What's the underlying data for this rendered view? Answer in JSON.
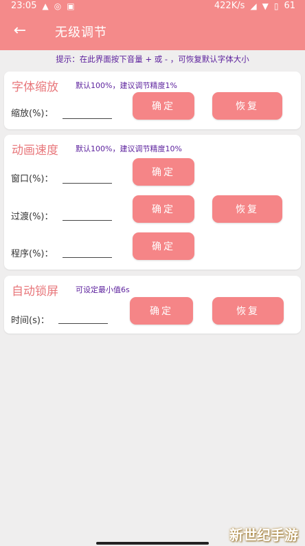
{
  "status": {
    "time": "23:05",
    "speed": "422K/s",
    "battery": "61"
  },
  "appbar": {
    "back_icon": "←",
    "title": "无级调节"
  },
  "hint": "提示：在此界面按下音量 + 或 - ，可恢复默认字体大小",
  "cards": [
    {
      "title": "字体缩放",
      "subtitle": "默认100%，建议调节精度1%",
      "rows": [
        {
          "label": "缩放(%)：",
          "value": "",
          "confirm": "确定",
          "restore": "恢复"
        }
      ]
    },
    {
      "title": "动画速度",
      "subtitle": "默认100%，建议调节精度10%",
      "rows": [
        {
          "label": "窗口(%)：",
          "value": "",
          "confirm": "确定"
        },
        {
          "label": "过渡(%)：",
          "value": "",
          "confirm": "确定",
          "restore": "恢复"
        },
        {
          "label": "程序(%)：",
          "value": "",
          "confirm": "确定"
        }
      ]
    },
    {
      "title": "自动锁屏",
      "subtitle": "可设定最小值6s",
      "rows": [
        {
          "label": "时间(s)：",
          "value": "",
          "confirm": "确定",
          "restore": "恢复"
        }
      ]
    }
  ],
  "watermark": "新世纪手游"
}
